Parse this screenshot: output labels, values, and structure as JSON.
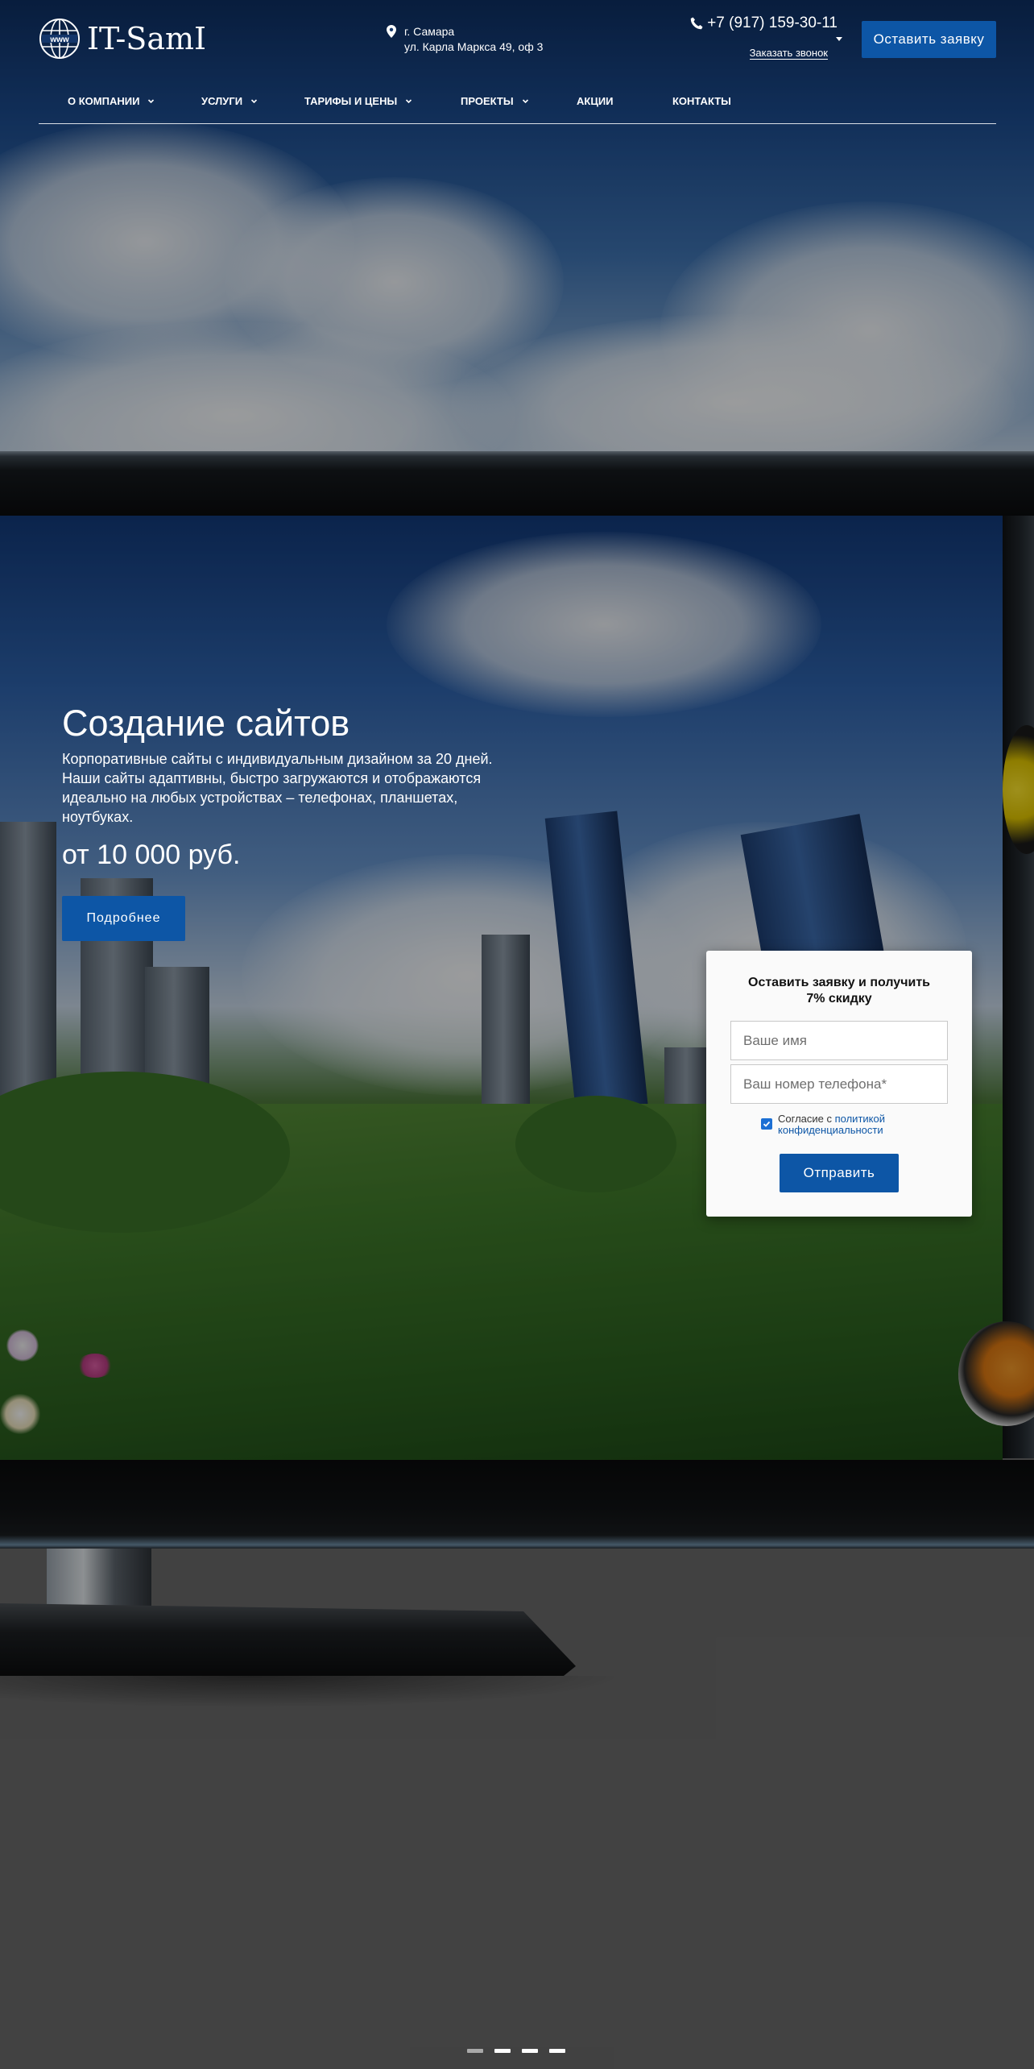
{
  "brand": {
    "name": "IT-SamI",
    "logo_text": "www"
  },
  "header": {
    "address_city": "г. Самара",
    "address_street": "ул. Карла Маркса 49, оф 3",
    "phone": "+7 (917) 159-30-11",
    "callback_label": "Заказать звонок",
    "cta_label": "Оставить заявку"
  },
  "nav": {
    "items": [
      {
        "label": "О компании",
        "icon": "chevron-down-icon"
      },
      {
        "label": "Услуги",
        "icon": "chevron-down-icon"
      },
      {
        "label": "Тарифы и цены",
        "icon": "chevron-down-icon"
      },
      {
        "label": "Проекты",
        "icon": "chevron-down-icon"
      },
      {
        "label": "Акции"
      },
      {
        "label": "Контакты"
      }
    ]
  },
  "hero": {
    "title": "Создание сайтов",
    "description": "Корпоративные сайты с индивидуальным дизайном за 20 дней. Наши сайты адаптивны, быстро загружаются и отображаются идеально на любых устройствах – телефонах, планшетах, ноутбуках.",
    "price": "от 10 000 руб.",
    "button_label": "Подробнее"
  },
  "form": {
    "title": "Оставить заявку и получить 7% скидку",
    "name_placeholder": "Ваше имя",
    "phone_placeholder": "Ваш номер телефона*",
    "consent_prefix": "Согласие с ",
    "consent_link_part1": "политикой",
    "consent_link_part2": "конфиденциальности",
    "consent_checked": true,
    "submit_label": "Отправить"
  },
  "slider": {
    "slide_count": 4,
    "active_index": 0
  },
  "colors": {
    "accent": "#0d56a6",
    "header_text": "#ffffff",
    "checkbox": "#1b6fd4"
  }
}
